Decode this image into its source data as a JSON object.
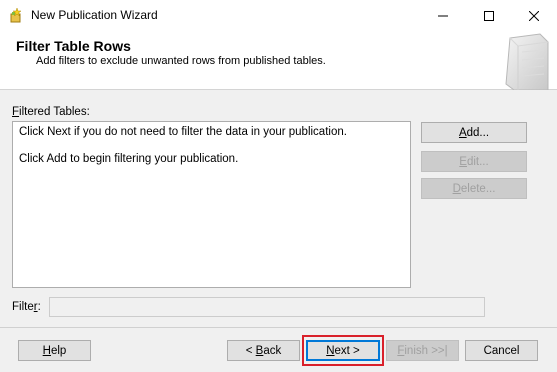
{
  "window": {
    "title": "New Publication Wizard",
    "app_icon": "wizard-app-icon",
    "controls": [
      "minimize-icon",
      "maximize-icon",
      "close-icon"
    ]
  },
  "header": {
    "title": "Filter Table Rows",
    "subtitle": "Add filters to exclude unwanted rows from published tables.",
    "graphic": "wizard-header-graphic"
  },
  "filtered_tables": {
    "label_accel": "F",
    "label_rest": "iltered Tables:",
    "lines": [
      "Click Next if you do not need to filter the data in your publication.",
      "Click Add to begin filtering your publication."
    ]
  },
  "side_buttons": {
    "add": {
      "accel": "A",
      "rest": "dd...",
      "enabled": true
    },
    "edit": {
      "accel": "E",
      "rest": "dit...",
      "enabled": false
    },
    "delete": {
      "accel": "D",
      "rest": "elete...",
      "enabled": false
    }
  },
  "filter": {
    "label_pre": "Filte",
    "label_accel": "r",
    "label_post": ":",
    "value": ""
  },
  "footer_buttons": {
    "help": {
      "accel": "H",
      "rest": "elp",
      "enabled": true
    },
    "back": {
      "pre": "< ",
      "accel": "B",
      "rest": "ack",
      "enabled": true
    },
    "next": {
      "accel": "N",
      "rest": "ext >",
      "enabled": true,
      "highlighted": true
    },
    "finish": {
      "accel": "F",
      "rest": "inish >>|",
      "enabled": false
    },
    "cancel": {
      "label": "Cancel",
      "enabled": true
    }
  },
  "colors": {
    "highlight": "#d9202a",
    "focus": "#0078d7",
    "disabled_text": "#a0a0a0"
  }
}
